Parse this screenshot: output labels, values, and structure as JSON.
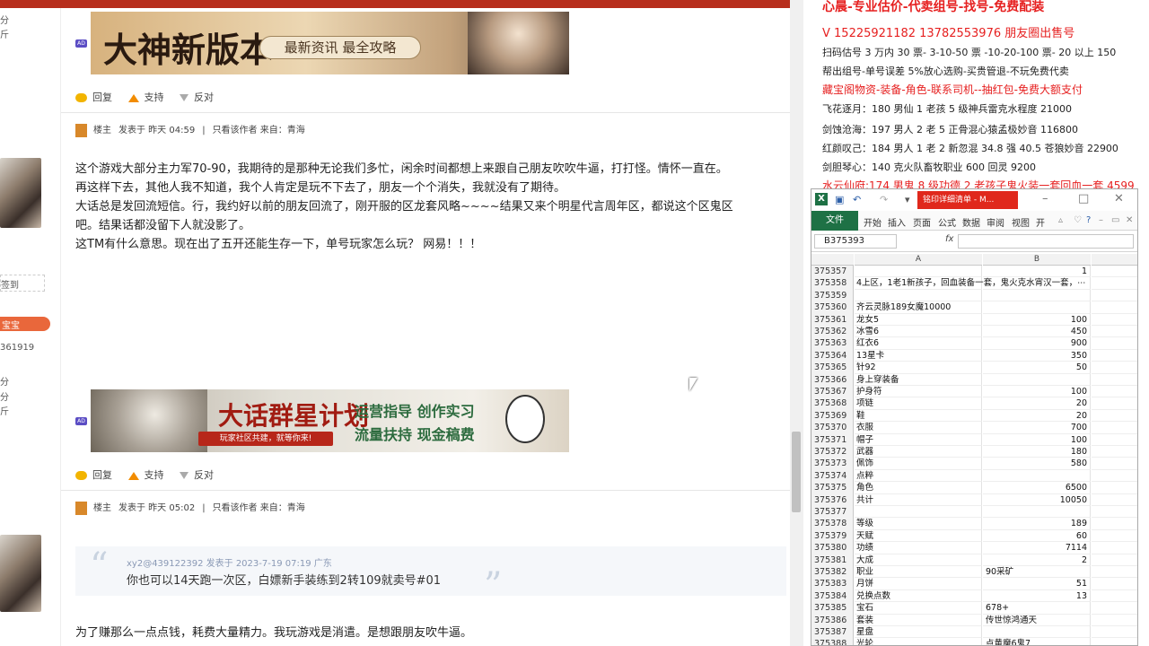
{
  "left_sidebar": {
    "t1": "分",
    "t2": "斤",
    "checkin": "签到",
    "baobao": "宝宝",
    "num": "361919",
    "t3": "分",
    "t4": "分",
    "t5": "斤"
  },
  "ads": [
    {
      "title": "大神新版本",
      "subtitle": "最新资讯 最全攻略",
      "tag": "AD"
    },
    {
      "title": "大话群星计划",
      "line1": "运营指导 创作实习",
      "line2": "流量扶持 现金稿费",
      "badge": "玩家社区共建，就等你来!",
      "tag": "AD"
    }
  ],
  "actions": {
    "reply": "回复",
    "support": "支持",
    "oppose": "反对"
  },
  "posts": [
    {
      "role": "楼主",
      "time": "发表于 昨天 04:59",
      "filter": "只看该作者",
      "from": "来自：青海",
      "lines": [
        "这个游戏大部分主力军70-90，我期待的是那种无论我们多忙，闲余时间都想上来跟自己朋友吹吹牛逼，打打怪。情怀一直在。",
        "再这样下去，其他人我不知道，我个人肯定是玩不下去了，朋友一个个消失，我就没有了期待。",
        "大话总是发回流短信。行，我约好以前的朋友回流了，刚开服的区龙套风略~~~~结果又来个明星代言周年区，都说这个区鬼区",
        "吧。结果话都没留下人就没影了。",
        "这TM有什么意思。现在出了五开还能生存一下，单号玩家怎么玩？ 网易！！！"
      ]
    },
    {
      "role": "楼主",
      "time": "发表于 昨天 05:02",
      "filter": "只看该作者",
      "from": "来自：青海",
      "quote_meta": "xy2@439122392 发表于 2023-7-19 07:19 广东",
      "quote_text": "你也可以14天跑一次区，白嫖新手装练到2转109就卖号#01",
      "lines": [
        "为了赚那么一点点钱，耗费大量精力。我玩游戏是消遣。是想跟朋友吹牛逼。"
      ]
    }
  ],
  "overlay": {
    "header": "心晨-专业估价-代卖组号-找号-免费配装",
    "phones": "V 15225921182   13782553976 朋友圈出售号",
    "lines": [
      {
        "text": "扫码估号 3 万内 30 票- 3-10-50 票  -10-20-100 票- 20 以上 150",
        "red": false
      },
      {
        "text": "帮出组号-单号误差 5%放心选购-买贵管退-不玩免费代卖",
        "red": false
      },
      {
        "text": "藏宝阁物资-装备-角色-联系司机--抽红包-免费大额支付",
        "red": true
      },
      {
        "text": "飞花逐月：180 男仙 1 老孩 5 级神兵雷克水程度 21000",
        "red": false
      },
      {
        "text": "剑蚀沧海：197 男人 2 老 5 正骨混心猿孟极妙音 116800",
        "red": false
      },
      {
        "text": "红颜叹己：184 男人 1 老 2 新忽混 34.8 强 40.5 苍狼妙音 22900",
        "red": false
      },
      {
        "text": "剑胆琴心：140 克火队畜牧职业 600 回灵 9200",
        "red": false
      },
      {
        "text": "水云仙府:174 男鬼 8 级功德 2 老孩子鬼火装一套回血一套 4599",
        "red": true
      }
    ]
  },
  "excel": {
    "logo": "X",
    "filename": "铭印详细清单 - M...",
    "menu": [
      "文件",
      "开始",
      "插入",
      "页面",
      "公式",
      "数据",
      "审阅",
      "视图",
      "开"
    ],
    "namebox": "B375393",
    "fx": "fx",
    "col_a": "A",
    "col_b": "B",
    "rows": [
      {
        "n": "375357",
        "a": "",
        "b": "1",
        "bl": false
      },
      {
        "n": "375358",
        "a": "4上区，1老1新孩子，回血装备一套，鬼火克水宵汉一套，⋯",
        "b": "",
        "bl": false
      },
      {
        "n": "375359",
        "a": "",
        "b": "",
        "bl": false
      },
      {
        "n": "375360",
        "a": "齐云灵脉189女魔10000",
        "b": "",
        "bl": false
      },
      {
        "n": "375361",
        "a": "龙女5",
        "b": "100",
        "bl": false
      },
      {
        "n": "375362",
        "a": "冰雪6",
        "b": "450",
        "bl": false
      },
      {
        "n": "375363",
        "a": "红衣6",
        "b": "900",
        "bl": false
      },
      {
        "n": "375364",
        "a": "13星卡",
        "b": "350",
        "bl": false
      },
      {
        "n": "375365",
        "a": "针92",
        "b": "50",
        "bl": false
      },
      {
        "n": "375366",
        "a": "身上穿装备",
        "b": "",
        "bl": false
      },
      {
        "n": "375367",
        "a": "护身符",
        "b": "100",
        "bl": false
      },
      {
        "n": "375368",
        "a": "项链",
        "b": "20",
        "bl": false
      },
      {
        "n": "375369",
        "a": "鞋",
        "b": "20",
        "bl": false
      },
      {
        "n": "375370",
        "a": "衣服",
        "b": "700",
        "bl": false
      },
      {
        "n": "375371",
        "a": "帽子",
        "b": "100",
        "bl": false
      },
      {
        "n": "375372",
        "a": "武器",
        "b": "180",
        "bl": false
      },
      {
        "n": "375373",
        "a": "佩饰",
        "b": "580",
        "bl": false
      },
      {
        "n": "375374",
        "a": "点粹",
        "b": "",
        "bl": false
      },
      {
        "n": "375375",
        "a": "角色",
        "b": "6500",
        "bl": false
      },
      {
        "n": "375376",
        "a": "共计",
        "b": "10050",
        "bl": false
      },
      {
        "n": "375377",
        "a": "",
        "b": "",
        "bl": false
      },
      {
        "n": "375378",
        "a": "等级",
        "b": "189",
        "bl": false
      },
      {
        "n": "375379",
        "a": "天赋",
        "b": "60",
        "bl": false
      },
      {
        "n": "375380",
        "a": "功绩",
        "b": "7114",
        "bl": false
      },
      {
        "n": "375381",
        "a": "大成",
        "b": "2",
        "bl": false
      },
      {
        "n": "375382",
        "a": "职业",
        "b": "90采矿",
        "bl": true
      },
      {
        "n": "375383",
        "a": "月饼",
        "b": "51",
        "bl": false
      },
      {
        "n": "375384",
        "a": "兑换点数",
        "b": "13",
        "bl": false
      },
      {
        "n": "375385",
        "a": "宝石",
        "b": "678+",
        "bl": true
      },
      {
        "n": "375386",
        "a": "套装",
        "b": "传世惊鸿通天",
        "bl": true
      },
      {
        "n": "375387",
        "a": "星盘",
        "b": "",
        "bl": false
      },
      {
        "n": "375388",
        "a": "光轮",
        "b": "点黄魔6鬼7",
        "bl": true
      }
    ]
  }
}
